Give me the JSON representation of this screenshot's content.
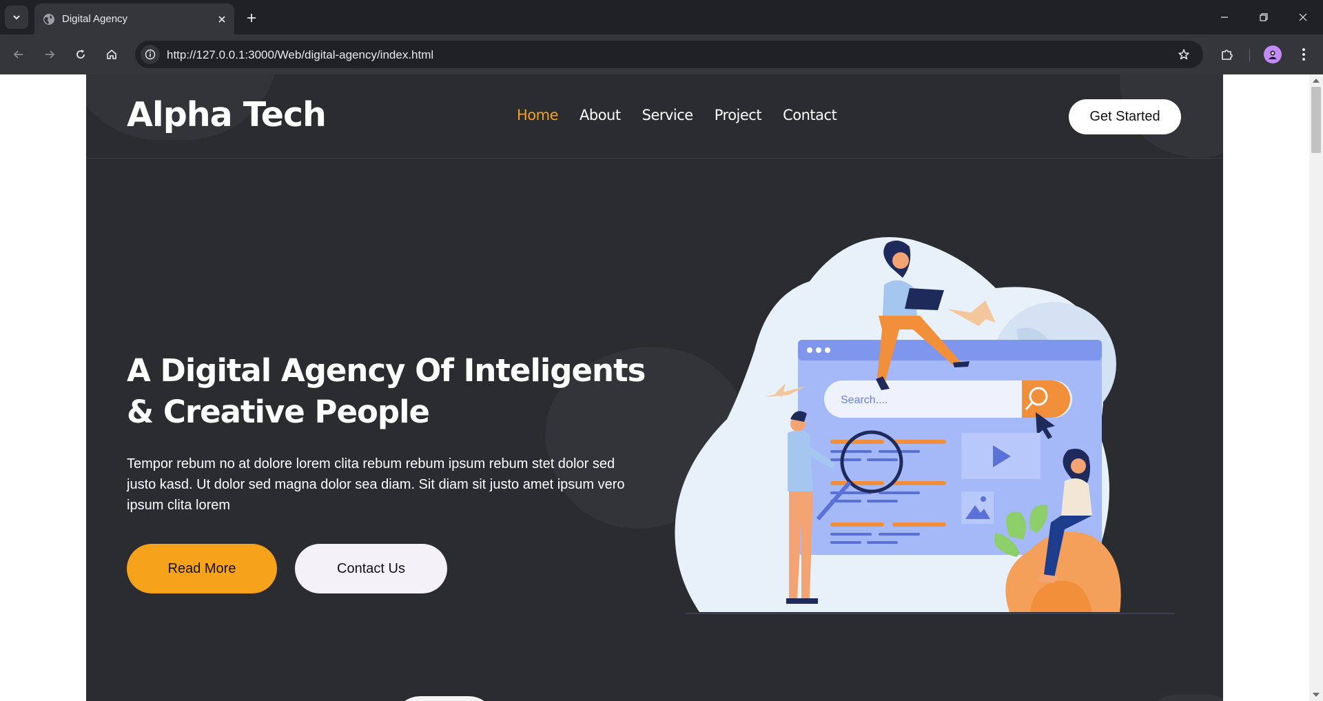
{
  "browser": {
    "tab_title": "Digital Agency",
    "url": "http://127.0.0.1:3000/Web/digital-agency/index.html"
  },
  "site": {
    "logo": "Alpha Tech",
    "nav": [
      {
        "label": "Home",
        "active": true
      },
      {
        "label": "About",
        "active": false
      },
      {
        "label": "Service",
        "active": false
      },
      {
        "label": "Project",
        "active": false
      },
      {
        "label": "Contact",
        "active": false
      }
    ],
    "cta": "Get Started"
  },
  "hero": {
    "title_line1": "A Digital Agency Of Inteligents",
    "title_line2": "& Creative People",
    "text": "Tempor rebum no at dolore lorem clita rebum rebum ipsum rebum stet dolor sed justo kasd. Ut dolor sed magna dolor sea diam. Sit diam sit justo amet ipsum vero ipsum clita lorem",
    "read_more": "Read More",
    "contact_us": "Contact Us",
    "search_placeholder": "Search...."
  },
  "colors": {
    "accent": "#f7a21b",
    "page_bg": "#2a2c30",
    "illustration_blob": "#e8f1fa",
    "illustration_screen": "#a5b8f7"
  }
}
